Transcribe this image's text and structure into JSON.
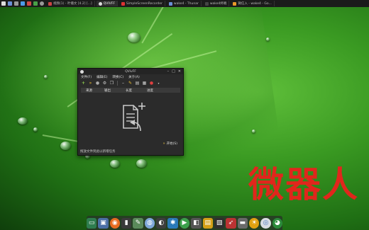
{
  "panel": {
    "tasks": [
      {
        "label": "视频(1) - 叶播文 [4.2] [...]",
        "active": false
      },
      {
        "label": "QVIVFF",
        "active": true
      },
      {
        "label": "SimpleScreenRecorder",
        "active": false
      },
      {
        "label": "wake4 - Thunar",
        "active": false
      },
      {
        "label": "wake4终端",
        "active": false
      },
      {
        "label": "微信入 - wake4 - Go...",
        "active": false
      }
    ]
  },
  "window": {
    "title": "QVivFF",
    "controls": [
      "–",
      "□",
      "✕"
    ],
    "menu": [
      "文件(F)",
      "编辑(E)",
      "转换(C)",
      "关于(A)"
    ],
    "columns": [
      "来源",
      "输出",
      "长度",
      "进度"
    ],
    "start_label": "开始(S)",
    "status": "拖放文件到此以新增任务"
  },
  "watermark": "微器人"
}
